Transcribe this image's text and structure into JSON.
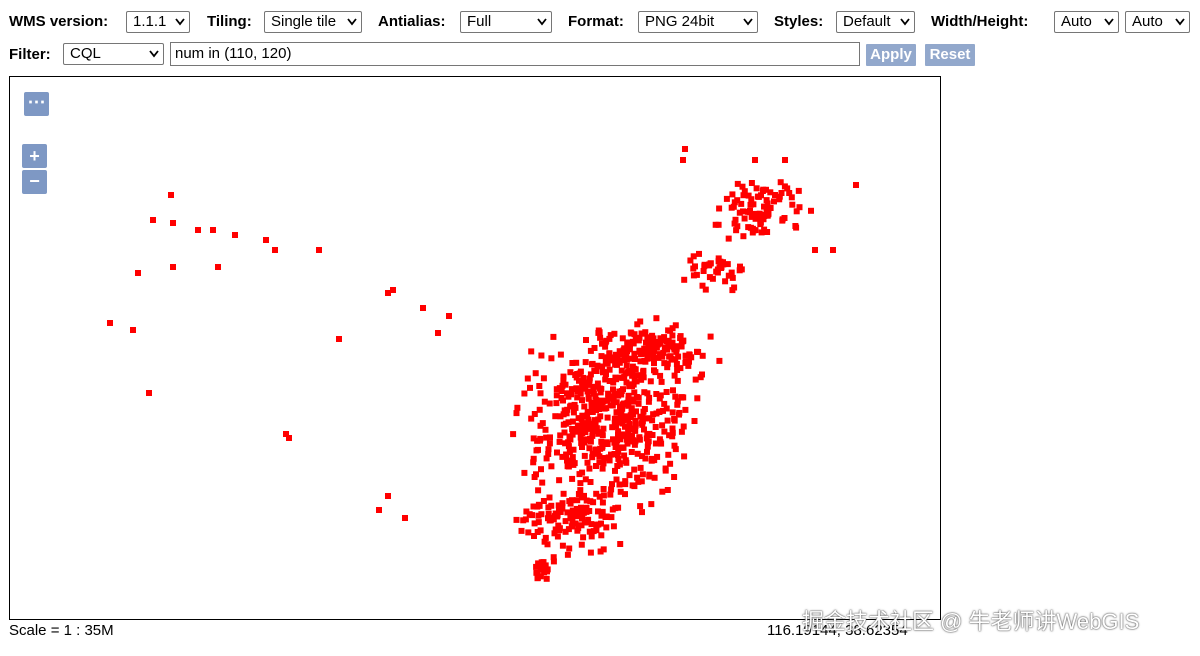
{
  "toolbar": {
    "wms_version": {
      "label": "WMS version:",
      "value": "1.1.1"
    },
    "tiling": {
      "label": "Tiling:",
      "value": "Single tile"
    },
    "antialias": {
      "label": "Antialias:",
      "value": "Full"
    },
    "format": {
      "label": "Format:",
      "value": "PNG 24bit"
    },
    "styles": {
      "label": "Styles:",
      "value": "Default"
    },
    "width_height": {
      "label": "Width/Height:",
      "width": "Auto",
      "height": "Auto"
    },
    "filter": {
      "label": "Filter:",
      "type": "CQL",
      "value": "num in (110, 120)"
    },
    "apply_label": "Apply",
    "reset_label": "Reset"
  },
  "map": {
    "controls": {
      "menu": "⋯",
      "zoom_in": "+",
      "zoom_out": "−"
    },
    "point_color": "#ff0000"
  },
  "status": {
    "scale": "Scale = 1 : 35M",
    "coords": "116.19144, 38.62354"
  },
  "watermark": "掘金技术社区 @ 牛老师讲WebGIS"
}
